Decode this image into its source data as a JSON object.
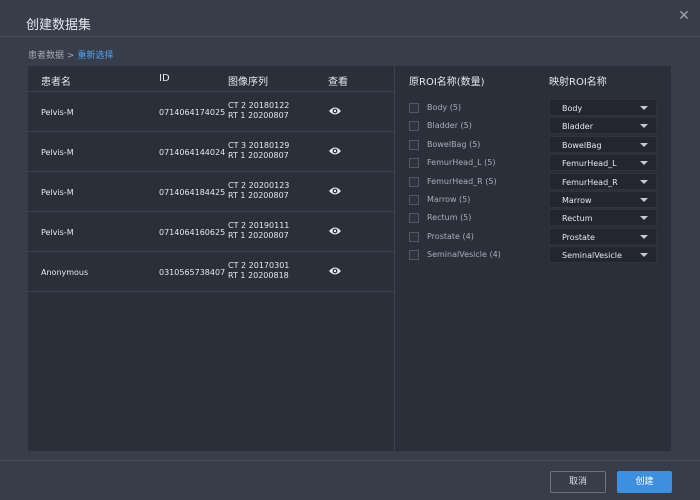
{
  "dialog": {
    "title": "创建数据集",
    "breadcrumb": {
      "current": "患者数据",
      "separator": ">",
      "link": "重新选择"
    }
  },
  "patients": {
    "headers": {
      "name": "患者名",
      "id": "ID",
      "series": "图像序列",
      "view": "查看"
    },
    "rows": [
      {
        "name": "Pelvis-M",
        "id": "0714064174025",
        "series": [
          "CT 2 20180122",
          "RT 1 20200807"
        ]
      },
      {
        "name": "Pelvis-M",
        "id": "0714064144024",
        "series": [
          "CT 3 20180129",
          "RT 1 20200807"
        ]
      },
      {
        "name": "Pelvis-M",
        "id": "0714064184425",
        "series": [
          "CT 2 20200123",
          "RT 1 20200807"
        ]
      },
      {
        "name": "Pelvis-M",
        "id": "0714064160625",
        "series": [
          "CT 2 20190111",
          "RT 1 20200807"
        ]
      },
      {
        "name": "Anonymous",
        "id": "0310565738407",
        "series": [
          "CT 2 20170301",
          "RT 1 20200818"
        ]
      }
    ]
  },
  "roi": {
    "headers": {
      "original": "原ROI名称(数量)",
      "mapped": "映射ROI名称"
    },
    "rows": [
      {
        "label": "Body (5)",
        "mapped": "Body"
      },
      {
        "label": "Bladder (5)",
        "mapped": "Bladder"
      },
      {
        "label": "BowelBag (5)",
        "mapped": "BowelBag"
      },
      {
        "label": "FemurHead_L (5)",
        "mapped": "FemurHead_L"
      },
      {
        "label": "FemurHead_R (5)",
        "mapped": "FemurHead_R"
      },
      {
        "label": "Marrow (5)",
        "mapped": "Marrow"
      },
      {
        "label": "Rectum (5)",
        "mapped": "Rectum"
      },
      {
        "label": "Prostate (4)",
        "mapped": "Prostate"
      },
      {
        "label": "SeminalVesicle (4)",
        "mapped": "SeminalVesicle"
      }
    ]
  },
  "footer": {
    "cancel": "取消",
    "create": "创建"
  },
  "icons": {
    "close": "close-icon",
    "view": "eye-icon",
    "dropdown": "chevron-down-icon"
  },
  "colors": {
    "accent": "#3f8fe0",
    "link": "#4da3f0",
    "background": "#383d4a",
    "panel": "#2b2f39"
  }
}
